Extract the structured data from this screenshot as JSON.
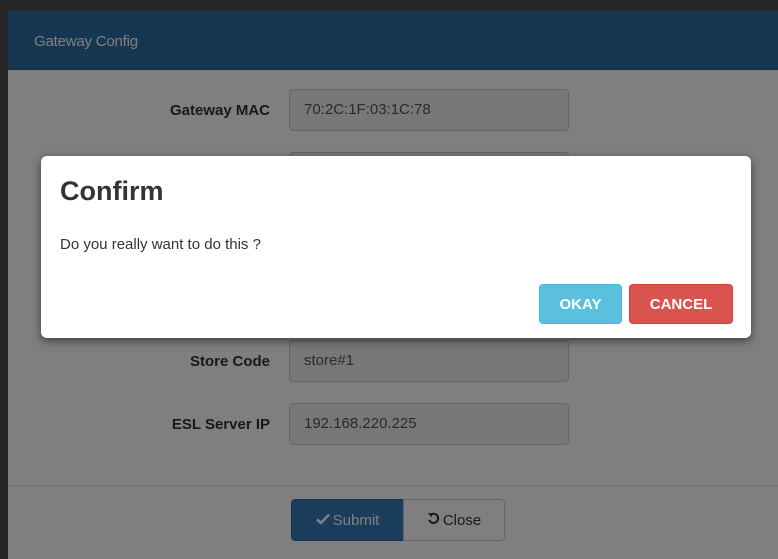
{
  "modal": {
    "title": "Gateway Config",
    "fields": [
      {
        "label": "Gateway MAC",
        "value": "70:2C:1F:03:1C:78"
      },
      {
        "label": "",
        "value": ""
      },
      {
        "label": "Store Code",
        "value": "store#1"
      },
      {
        "label": "ESL Server IP",
        "value": "192.168.220.225"
      }
    ],
    "footer": {
      "submit_label": "Submit",
      "close_label": "Close",
      "submit_icon": "check-icon",
      "close_icon": "undo-icon"
    }
  },
  "confirm": {
    "title": "Confirm",
    "message": "Do you really want to do this ?",
    "okay_label": "OKAY",
    "cancel_label": "CANCEL"
  },
  "colors": {
    "header": "#2e6da4",
    "primary": "#337ab7",
    "info": "#5bc0de",
    "danger": "#d9534f"
  }
}
